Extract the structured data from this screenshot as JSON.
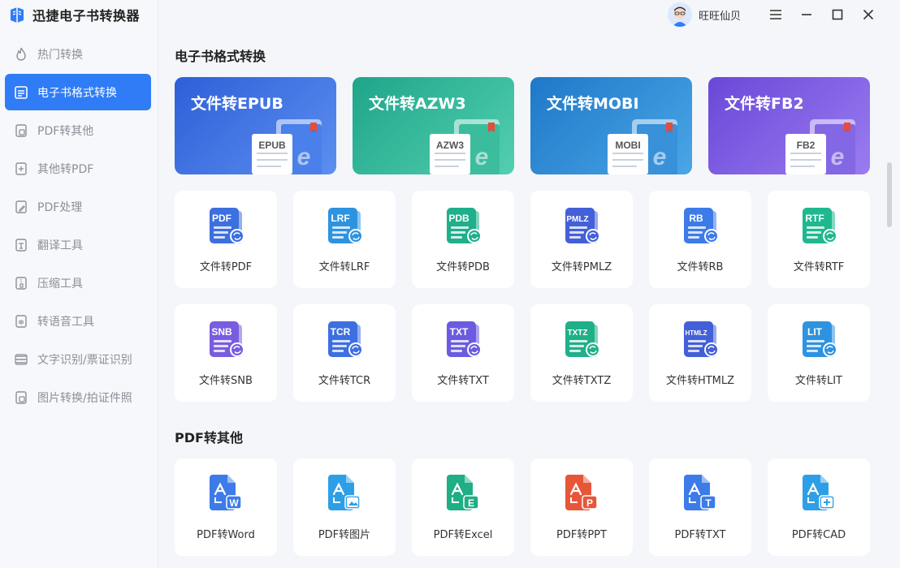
{
  "app": {
    "title": "迅捷电子书转换器"
  },
  "user": {
    "name": "旺旺仙贝"
  },
  "sidebar": {
    "items": [
      {
        "label": "热门转换",
        "icon": "fire-icon",
        "active": false
      },
      {
        "label": "电子书格式转换",
        "icon": "ebook-icon",
        "active": true
      },
      {
        "label": "PDF转其他",
        "icon": "pdf-export-icon",
        "active": false
      },
      {
        "label": "其他转PDF",
        "icon": "pdf-import-icon",
        "active": false
      },
      {
        "label": "PDF处理",
        "icon": "pdf-edit-icon",
        "active": false
      },
      {
        "label": "翻译工具",
        "icon": "translate-icon",
        "active": false
      },
      {
        "label": "压缩工具",
        "icon": "compress-icon",
        "active": false
      },
      {
        "label": "转语音工具",
        "icon": "voice-icon",
        "active": false
      },
      {
        "label": "文字识别/票证识别",
        "icon": "ocr-icon",
        "active": false
      },
      {
        "label": "图片转换/拍证件照",
        "icon": "image-icon",
        "active": false
      }
    ]
  },
  "sections": {
    "ebook": {
      "title": "电子书格式转换",
      "big_cards": [
        {
          "title": "文件转EPUB",
          "badge": "EPUB",
          "from": "#2f5fd8",
          "to": "#5c8ff0",
          "book": "#3f78e8"
        },
        {
          "title": "文件转AZW3",
          "badge": "AZW3",
          "from": "#1fa58a",
          "to": "#53cfb0",
          "book": "#2fb897"
        },
        {
          "title": "文件转MOBI",
          "badge": "MOBI",
          "from": "#1f78c8",
          "to": "#4aa6e6",
          "book": "#2c8ad6"
        },
        {
          "title": "文件转FB2",
          "badge": "FB2",
          "from": "#6a48d8",
          "to": "#9a7cf0",
          "book": "#7c5de2"
        }
      ],
      "row1": [
        {
          "label": "文件转PDF",
          "badge": "PDF",
          "color": "#3d6fe0"
        },
        {
          "label": "文件转LRF",
          "badge": "LRF",
          "color": "#2e93e0"
        },
        {
          "label": "文件转PDB",
          "badge": "PDB",
          "color": "#1faf8a"
        },
        {
          "label": "文件转PMLZ",
          "badge": "PMLZ",
          "color": "#4460d8"
        },
        {
          "label": "文件转RB",
          "badge": "RB",
          "color": "#3d7be8"
        },
        {
          "label": "文件转RTF",
          "badge": "RTF",
          "color": "#1fb88f"
        }
      ],
      "row2": [
        {
          "label": "文件转SNB",
          "badge": "SNB",
          "color": "#7a5ce0"
        },
        {
          "label": "文件转TCR",
          "badge": "TCR",
          "color": "#3d6fe0"
        },
        {
          "label": "文件转TXT",
          "badge": "TXT",
          "color": "#6b5be0"
        },
        {
          "label": "文件转TXTZ",
          "badge": "TXTZ",
          "color": "#1fb08a"
        },
        {
          "label": "文件转HTMLZ",
          "badge": "HTMLZ",
          "color": "#4460d8"
        },
        {
          "label": "文件转LIT",
          "badge": "LIT",
          "color": "#2e93e0"
        }
      ]
    },
    "pdf": {
      "title": "PDF转其他",
      "row": [
        {
          "label": "PDF转Word",
          "badge": "W",
          "color": "#3d7be8"
        },
        {
          "label": "PDF转图片",
          "badge": "img",
          "color": "#2e9fe6"
        },
        {
          "label": "PDF转Excel",
          "badge": "E",
          "color": "#1fae86"
        },
        {
          "label": "PDF转PPT",
          "badge": "P",
          "color": "#e8563a"
        },
        {
          "label": "PDF转TXT",
          "badge": "T",
          "color": "#3d7be8"
        },
        {
          "label": "PDF转CAD",
          "badge": "cad",
          "color": "#2e9fe6"
        }
      ]
    }
  }
}
